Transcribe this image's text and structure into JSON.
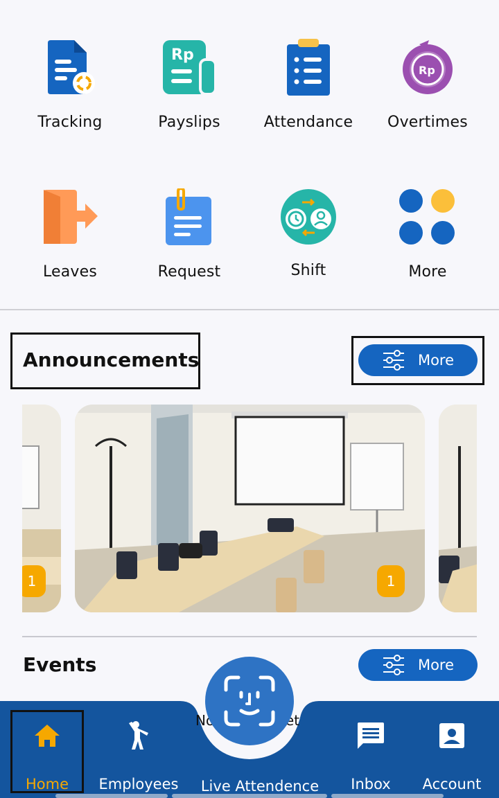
{
  "menu": {
    "items": [
      {
        "label": "Tracking",
        "icon": "tracking-doc-icon"
      },
      {
        "label": "Payslips",
        "icon": "payslip-rp-icon"
      },
      {
        "label": "Attendance",
        "icon": "clipboard-list-icon"
      },
      {
        "label": "Overtimes",
        "icon": "clock-rp-icon"
      },
      {
        "label": "Leaves",
        "icon": "exit-door-icon"
      },
      {
        "label": "Request",
        "icon": "clipped-note-icon"
      },
      {
        "label": "Shift",
        "icon": "shift-swap-icon"
      },
      {
        "label": "More",
        "icon": "four-dots-icon"
      }
    ]
  },
  "announcements": {
    "title": "Announcements",
    "more_label": "More",
    "cards": [
      {
        "badge": "1"
      },
      {
        "badge": "1"
      },
      {
        "badge": ""
      }
    ]
  },
  "events": {
    "title": "Events",
    "more_label": "More",
    "empty_text_left": "No",
    "empty_text_right": "et"
  },
  "bottom_nav": {
    "items": [
      {
        "label": "Home",
        "icon": "home-icon",
        "active": true
      },
      {
        "label": "Employees",
        "icon": "person-waving-icon",
        "active": false
      },
      {
        "label": "Live Attendence",
        "icon": "face-scan-icon",
        "active": false
      },
      {
        "label": "Inbox",
        "icon": "message-icon",
        "active": false
      },
      {
        "label": "Account",
        "icon": "account-box-icon",
        "active": false
      }
    ]
  },
  "colors": {
    "primary_blue": "#1565c0",
    "accent_orange": "#f6a800",
    "teal": "#26b5a8",
    "purple": "#9b4fb0",
    "light_orange": "#ff9a57",
    "light_blue": "#4c94ee",
    "nav_background": "#14559e"
  }
}
